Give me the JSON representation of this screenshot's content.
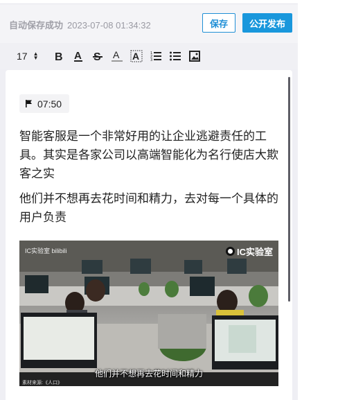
{
  "status": {
    "saved_text": "自动保存成功",
    "saved_time": "2023-07-08 01:34:32"
  },
  "actions": {
    "save_label": "保存",
    "publish_label": "公开发布"
  },
  "toolbar": {
    "font_size": "17",
    "tools": [
      "bold-icon",
      "underline-icon",
      "strikethrough-icon",
      "font-color-icon",
      "highlight-icon",
      "ordered-list-icon",
      "bullet-list-icon",
      "image-icon"
    ]
  },
  "editor": {
    "timestamp": "07:50",
    "paragraphs": [
      "智能客服是一个非常好用的让企业逃避责任的工具。其实是各家公司以高端智能化为名行使店大欺客之实",
      "他们并不想再去花时间和精力，去对每一个具体的用户负责"
    ],
    "video": {
      "watermark_left": "IC实验室 bilibili",
      "watermark_right": "IC实验室",
      "subtitle": "他们并不想再去花时间和精力",
      "credit": "素材来源:《人口》"
    }
  },
  "colors": {
    "primary": "#1997dc",
    "background": "#efeff4",
    "muted_text": "#9a9aa3"
  }
}
